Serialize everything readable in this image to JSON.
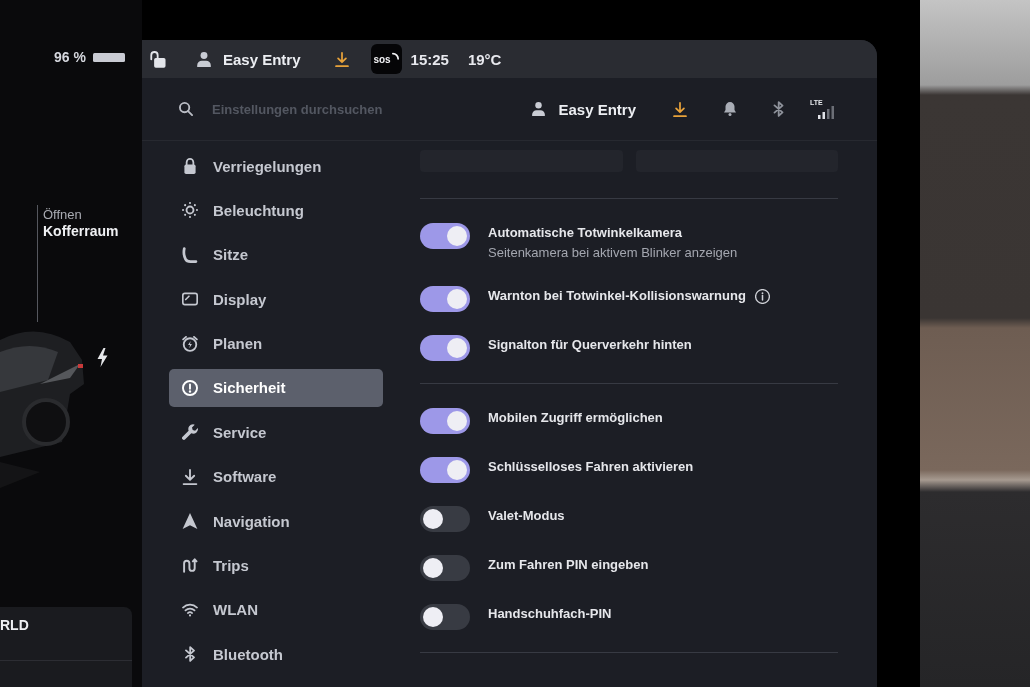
{
  "left_panel": {
    "battery": "96 %",
    "trunk": {
      "action": "Öffnen",
      "label": "Kofferraum"
    },
    "media_card": {
      "title": "RLD"
    }
  },
  "status_bar": {
    "profile": "Easy Entry",
    "sos": "sos",
    "time": "15:25",
    "temperature": "19°C"
  },
  "header": {
    "search": {
      "placeholder": "Einstellungen durchsuchen"
    },
    "profile": "Easy Entry",
    "network": "LTE"
  },
  "sidebar": {
    "items": [
      {
        "label": "Verriegelungen",
        "selected": false
      },
      {
        "label": "Beleuchtung",
        "selected": false
      },
      {
        "label": "Sitze",
        "selected": false
      },
      {
        "label": "Display",
        "selected": false
      },
      {
        "label": "Planen",
        "selected": false
      },
      {
        "label": "Sicherheit",
        "selected": true
      },
      {
        "label": "Service",
        "selected": false
      },
      {
        "label": "Software",
        "selected": false
      },
      {
        "label": "Navigation",
        "selected": false
      },
      {
        "label": "Trips",
        "selected": false
      },
      {
        "label": "WLAN",
        "selected": false
      },
      {
        "label": "Bluetooth",
        "selected": false
      }
    ]
  },
  "settings": {
    "sections": [
      {
        "toggles": [
          {
            "label": "Automatische Totwinkelkamera",
            "description": "Seitenkamera bei aktivem Blinker anzeigen",
            "on": true,
            "info": false
          },
          {
            "label": "Warnton bei Totwinkel-Kollisionswarnung",
            "on": true,
            "info": true
          },
          {
            "label": "Signalton für Querverkehr hinten",
            "on": true,
            "info": false
          }
        ]
      },
      {
        "toggles": [
          {
            "label": "Mobilen Zugriff ermöglichen",
            "on": true,
            "info": false
          },
          {
            "label": "Schlüsselloses Fahren aktivieren",
            "on": true,
            "info": false
          },
          {
            "label": "Valet-Modus",
            "on": false,
            "info": false
          },
          {
            "label": "Zum Fahren PIN eingeben",
            "on": false,
            "info": false
          },
          {
            "label": "Handschuhfach-PIN",
            "on": false,
            "info": false
          }
        ]
      }
    ]
  }
}
